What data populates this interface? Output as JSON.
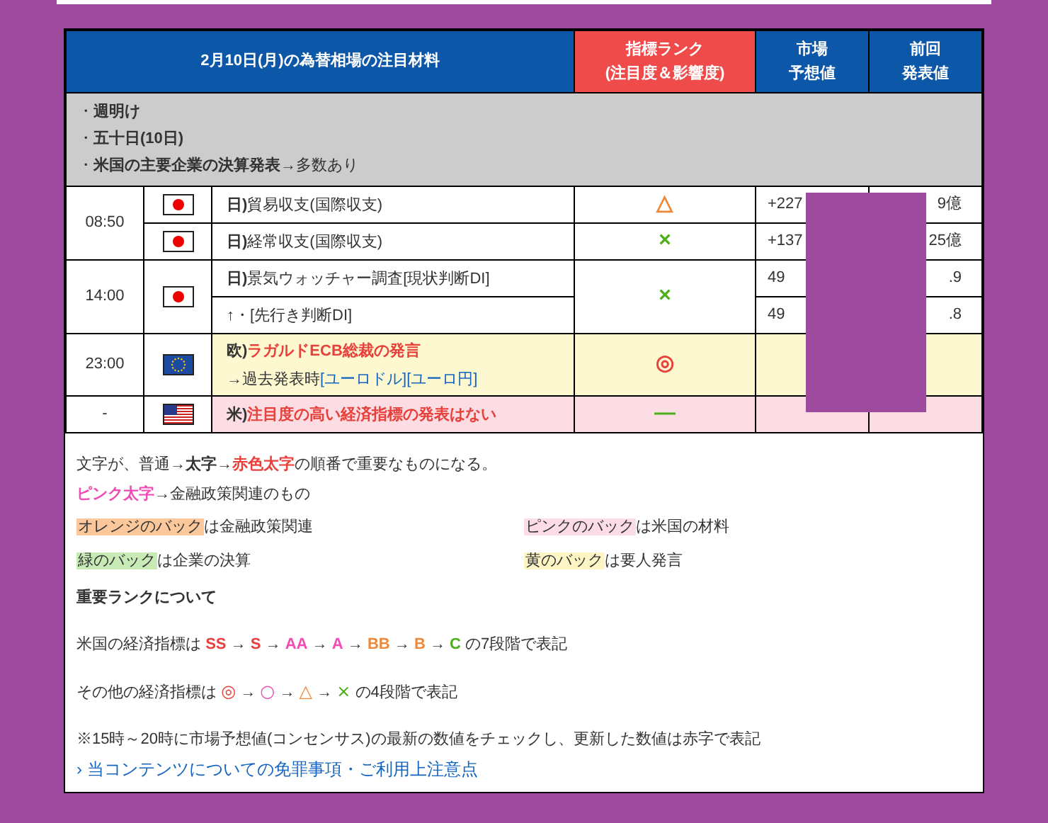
{
  "header": {
    "title": "2月10日(月)の為替相場の注目材料",
    "rank": [
      "指標ランク",
      "(注目度＆影響度)"
    ],
    "market": [
      "市場",
      "予想値"
    ],
    "previous": [
      "前回",
      "発表値"
    ]
  },
  "notes": [
    "・**週明け**",
    "・**五十日(10日)**",
    "・**米国の主要企業の決算発表**→多数あり"
  ],
  "rows": [
    {
      "time": "08:50",
      "flag": {
        "kind": "jp"
      },
      "country": "日)",
      "name": "貿易収支(国際収支)",
      "rank": {
        "symbol": "△",
        "color": "#f0883a"
      },
      "market": "+227",
      "previous": "9億"
    },
    {
      "flag": {
        "kind": "jp"
      },
      "country": "日)",
      "name": "経常収支(国際収支)",
      "rank": {
        "symbol": "×",
        "color": "#4caf1a"
      },
      "market": "+137",
      "previous": "25億"
    },
    {
      "time": "14:00",
      "flag": {
        "kind": "jp"
      },
      "country": "日)",
      "name": "景気ウォッチャー調査[現状判断DI]",
      "rank": {
        "symbol": "×",
        "color": "#4caf1a"
      },
      "market": "49",
      "previous": ".9"
    },
    {
      "country": "↑",
      "name": "・[先行き判断DI]",
      "market": "49",
      "previous": ".8"
    },
    {
      "time": "23:00",
      "flag": {
        "kind": "eu"
      },
      "country": "欧)",
      "name": "ラガルドECB総裁の発言",
      "name_red": true,
      "color": "#fdf8d0",
      "sub": "→過去発表時",
      "links": [
        "[ユーロドル]",
        "[ユーロ円]"
      ],
      "rank": {
        "symbol": "◎",
        "color": "#e8413c"
      }
    },
    {
      "time": "-",
      "flag": {
        "kind": "us"
      },
      "country": "米)",
      "name": "注目度の高い経済指標の発表はない",
      "name_red": true,
      "color": "#fcdde3",
      "rank": {
        "symbol": "—",
        "color": "#4caf1a"
      }
    }
  ],
  "legend": [
    [
      {
        "text": "文字が、普通→"
      },
      {
        "text": "太字",
        "bold": true
      },
      {
        "text": "→"
      },
      {
        "text": "赤色太字",
        "bold": true,
        "color": "#e8413c"
      },
      {
        "text": "の順番で重要なものになる。"
      }
    ],
    [
      {
        "text": "ピンク太字",
        "bold": true,
        "color": "#f04cb4"
      },
      {
        "text": "→金融政策関連のもの"
      }
    ]
  ],
  "backs": [
    {
      "label": "オレンジのバック",
      "text": "は金融政策関連",
      "color": "#fcc89b"
    },
    {
      "label": "ピンクのバック",
      "text": "は米国の材料",
      "color": "#fcdce6"
    },
    {
      "label": "緑のバック",
      "text": "は企業の決算",
      "color": "#c8eab4"
    },
    {
      "label": "黄のバック",
      "text": "は要人発言",
      "color": "#fdf5c4"
    }
  ],
  "rank_title": "重要ランクについて",
  "rank_lines": [
    [
      {
        "text": "米国の経済指標は "
      },
      {
        "text": "SS",
        "bold": true,
        "color": "#e8413c"
      },
      {
        "text": " → "
      },
      {
        "text": "S",
        "bold": true,
        "color": "#e8413c"
      },
      {
        "text": " → "
      },
      {
        "text": "AA",
        "bold": true,
        "color": "#f04cb4"
      },
      {
        "text": " → "
      },
      {
        "text": "A",
        "bold": true,
        "color": "#f04cb4"
      },
      {
        "text": " → "
      },
      {
        "text": "BB",
        "bold": true,
        "color": "#f0883a"
      },
      {
        "text": " → "
      },
      {
        "text": "B",
        "bold": true,
        "color": "#f0883a"
      },
      {
        "text": " → "
      },
      {
        "text": "C",
        "bold": true,
        "color": "#4caf1a"
      },
      {
        "text": " の7段階で表記"
      }
    ],
    [
      {
        "text": "その他の経済指標は "
      },
      {
        "text": "◎",
        "color": "#e8413c"
      },
      {
        "text": " → "
      },
      {
        "text": "○",
        "color": "#f04cb4"
      },
      {
        "text": " → "
      },
      {
        "text": "△",
        "color": "#f0883a"
      },
      {
        "text": " → "
      },
      {
        "text": "×",
        "color": "#4caf1a"
      },
      {
        "text": " の4段階で表記"
      }
    ]
  ],
  "footnote": "※15時～20時に市場予想値(コンセンサス)の最新の数値をチェックし、更新した数値は赤字で表記",
  "disclaimer_link": "› 当コンテンツについての免罪事項・ご利用上注意点"
}
